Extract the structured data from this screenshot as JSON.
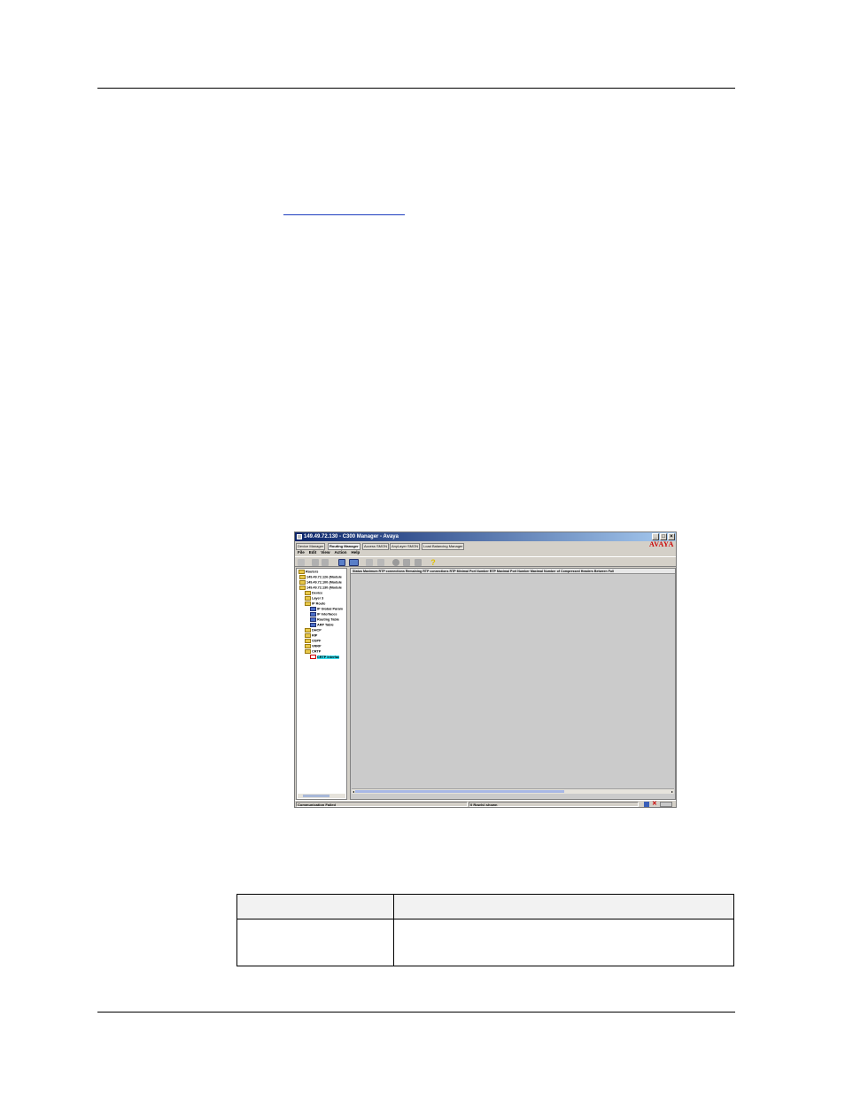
{
  "screenshot": {
    "window_title": "149.49.72.130 - C300 Manager - Avaya",
    "logo_text": "AVAYA",
    "tabs": [
      {
        "label": "Device Manager",
        "active": false
      },
      {
        "label": "Routing Manager",
        "active": true
      },
      {
        "label": "Access SMON",
        "active": false
      },
      {
        "label": "AnyLayer SMON",
        "active": false
      },
      {
        "label": "Load Balancing Manager",
        "active": false
      }
    ],
    "menu": [
      "File",
      "Edit",
      "View",
      "Action",
      "Help"
    ],
    "toolbar_icons": [
      "undo-icon",
      "copy-icon",
      "paste-icon",
      "view-icon",
      "graph-icon",
      "print-icon",
      "save-icon",
      "record-icon",
      "upload-icon",
      "tool-icon",
      "help-icon"
    ],
    "tree": {
      "items": [
        {
          "label": "Routers",
          "indent": 0,
          "icon": "folder"
        },
        {
          "label": "149.49.72.126 (Module",
          "indent": 1,
          "icon": "device"
        },
        {
          "label": "149.49.72.100 (Module",
          "indent": 1,
          "icon": "device"
        },
        {
          "label": "149.49.72.130 (Module",
          "indent": 1,
          "icon": "device"
        },
        {
          "label": "Device",
          "indent": 2,
          "icon": "folder"
        },
        {
          "label": "Layer 3",
          "indent": 2,
          "icon": "folder"
        },
        {
          "label": "IP Route",
          "indent": 2,
          "icon": "folder"
        },
        {
          "label": "IP Global Param",
          "indent": 3,
          "icon": "blue"
        },
        {
          "label": "IP Interfaces",
          "indent": 3,
          "icon": "blue"
        },
        {
          "label": "Routing Table",
          "indent": 3,
          "icon": "blue"
        },
        {
          "label": "ARP Table",
          "indent": 3,
          "icon": "blue"
        },
        {
          "label": "DHCP",
          "indent": 2,
          "icon": "folder"
        },
        {
          "label": "RIP",
          "indent": 2,
          "icon": "folder"
        },
        {
          "label": "OSPF",
          "indent": 2,
          "icon": "folder"
        },
        {
          "label": "VRRP",
          "indent": 2,
          "icon": "folder"
        },
        {
          "label": "CRTP",
          "indent": 2,
          "icon": "folder"
        },
        {
          "label": "CRTP Interfac",
          "indent": 3,
          "icon": "red",
          "selected": true
        }
      ]
    },
    "table_header": "Status  Maximum RTP connections  Remaining RTP connections  RTP Minimal Port Number  RTP Maximal Port Number  Maximal Number of Compressed Headers  Between Full",
    "status": {
      "left": "Communication Failed",
      "middle": "0 Row(s) shown"
    }
  },
  "doc_table": {
    "headers": [
      "",
      ""
    ],
    "rows": [
      [
        "",
        ""
      ]
    ]
  },
  "colors": {
    "titlebar_start": "#0a246a",
    "titlebar_end": "#a6caf0",
    "window_bg": "#d4d0c8",
    "selection": "#33ddee",
    "logo": "#cc0000",
    "link": "#1f3fbf"
  }
}
